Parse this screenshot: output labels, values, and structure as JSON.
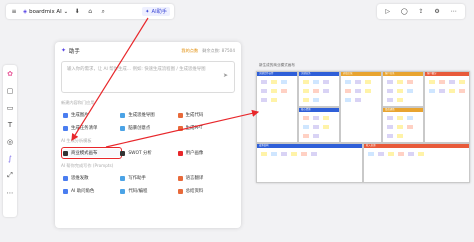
{
  "toolbar": {
    "brand": "boardmix AI",
    "brand_chevron": "⌄",
    "ai_button": "AI助手",
    "icons": [
      "menu-icon",
      "logo-icon",
      "download-icon",
      "tag-icon",
      "search-icon"
    ]
  },
  "right_toolbar": {
    "icons": [
      "play-icon",
      "comment-icon",
      "share-icon",
      "settings-icon",
      "more-icon"
    ]
  },
  "left_toolbar": {
    "icons": [
      "template-icon",
      "frame-icon",
      "note-icon",
      "text-icon",
      "shape-icon",
      "pen-icon",
      "connector-icon",
      "more-icon"
    ]
  },
  "panel": {
    "title": "助手",
    "credits_label": "我的点数",
    "credits_value": "",
    "total_label": "剩余点数: 87504",
    "prompt_placeholder": "输入你的需求，让 AI 帮你生成… 例如: 快速生成流程图 / 生成思维导图",
    "section1": "新建内容和门应用",
    "section2": "AI 生成分析模板",
    "section3": "AI 帮你完成写作 (Prompts)",
    "items1": [
      {
        "label": "生成图片",
        "color": "#4a7df0"
      },
      {
        "label": "生成思维导图",
        "color": "#4ba3e6"
      },
      {
        "label": "生成代码",
        "color": "#e86a3a"
      },
      {
        "label": "生成任务清单",
        "color": "#4a7df0"
      },
      {
        "label": "脑暴创意点",
        "color": "#4ba3e6"
      },
      {
        "label": "生成PPT",
        "color": "#e86a3a"
      }
    ],
    "items2": [
      {
        "label": "商业模式画布",
        "color": "#333333"
      },
      {
        "label": "SWOT 分析",
        "color": "#333333"
      },
      {
        "label": "用户画像",
        "color": "#e8272b"
      }
    ],
    "items3": [
      {
        "label": "思维发散",
        "color": "#4a7df0"
      },
      {
        "label": "写作助手",
        "color": "#4ba3e6"
      },
      {
        "label": "语言翻译",
        "color": "#e86a3a"
      },
      {
        "label": "AI 助问角色",
        "color": "#4a7df0"
      },
      {
        "label": "代码/编程",
        "color": "#4ba3e6"
      },
      {
        "label": "总结资料",
        "color": "#e86a3a"
      }
    ]
  },
  "board": {
    "title": "新生成的商业模式画布",
    "headers": [
      {
        "label": "关键合作伙伴",
        "color": "#2f5fd8"
      },
      {
        "label": "关键业务",
        "color": "#2f5fd8"
      },
      {
        "label": "价值主张",
        "color": "#e8a430"
      },
      {
        "label": "客户关系",
        "color": "#e8a430"
      },
      {
        "label": "客户细分",
        "color": "#e85a3a"
      },
      {
        "label": "核心资源",
        "color": "#2f5fd8"
      },
      {
        "label": "渠道通路",
        "color": "#e8a430"
      },
      {
        "label": "成本结构",
        "color": "#2f5fd8"
      },
      {
        "label": "收入来源",
        "color": "#e85a3a"
      }
    ],
    "sticky_colors": [
      "#d9d3f5",
      "#fff3a8",
      "#cfe6ff",
      "#d9d3f5",
      "#fff3a8",
      "#ffd1c4"
    ]
  },
  "accent": "#e8272b"
}
